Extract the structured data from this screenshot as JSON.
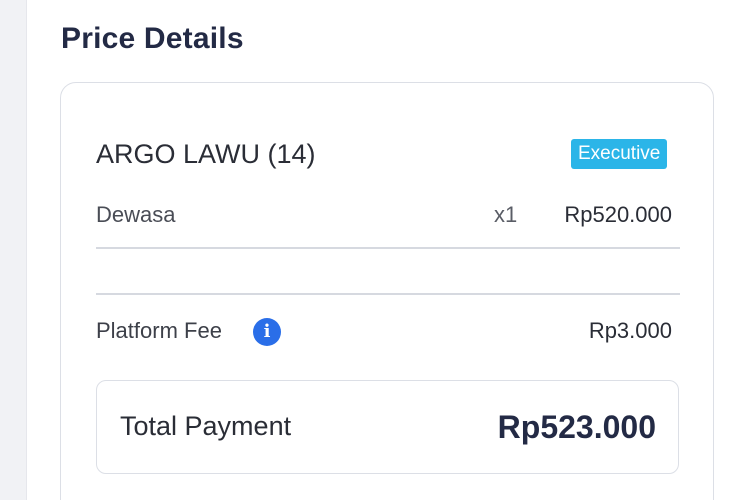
{
  "price_details": {
    "title": "Price Details",
    "train": {
      "name": "ARGO LAWU (14)",
      "class_badge": "Executive",
      "badge_color": "#2bb5e8"
    },
    "passenger_line": {
      "label": "Dewasa",
      "quantity": "x1",
      "price": "Rp520.000"
    },
    "platform_fee": {
      "label": "Platform Fee",
      "info_icon": "info-icon",
      "info_glyph": "i",
      "value": "Rp3.000"
    },
    "total": {
      "label": "Total Payment",
      "value": "Rp523.000"
    }
  }
}
